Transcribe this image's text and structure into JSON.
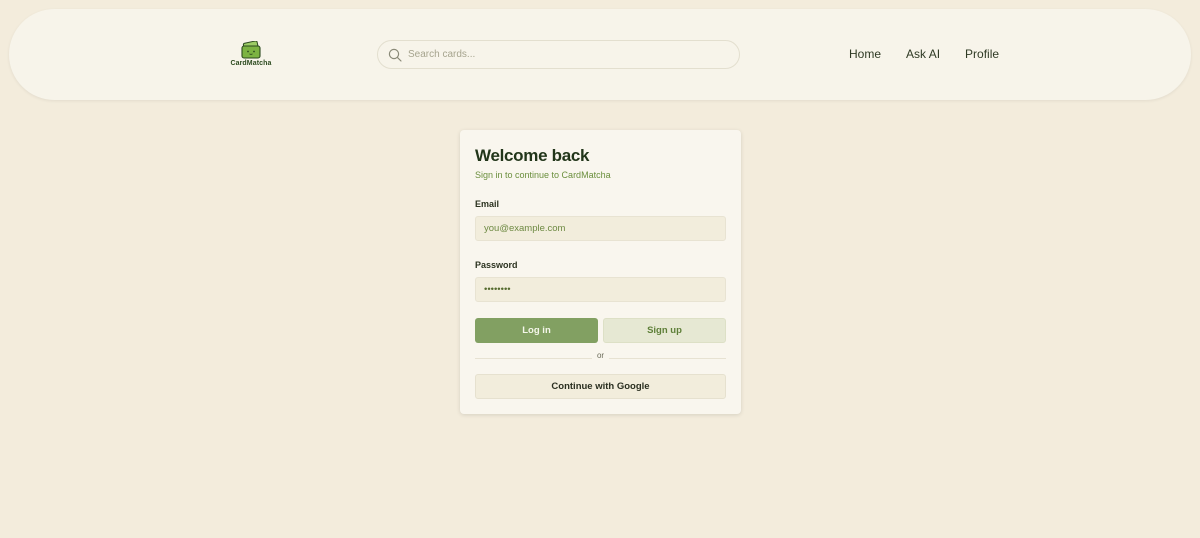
{
  "header": {
    "logo_text": "CardMatcha",
    "search": {
      "placeholder": "Search cards..."
    },
    "nav": [
      {
        "label": "Home"
      },
      {
        "label": "Ask AI"
      },
      {
        "label": "Profile"
      }
    ]
  },
  "login": {
    "title": "Welcome back",
    "subtitle": "Sign in to continue to CardMatcha",
    "email_label": "Email",
    "email_placeholder": "you@example.com",
    "password_label": "Password",
    "password_masked": "••••••••",
    "login_button": "Log in",
    "signup_button": "Sign up",
    "divider_text": "or",
    "google_button": "Continue with Google"
  },
  "colors": {
    "background": "#f3ecdc",
    "accent": "#82a062",
    "subtitle": "#6b8f3d"
  }
}
